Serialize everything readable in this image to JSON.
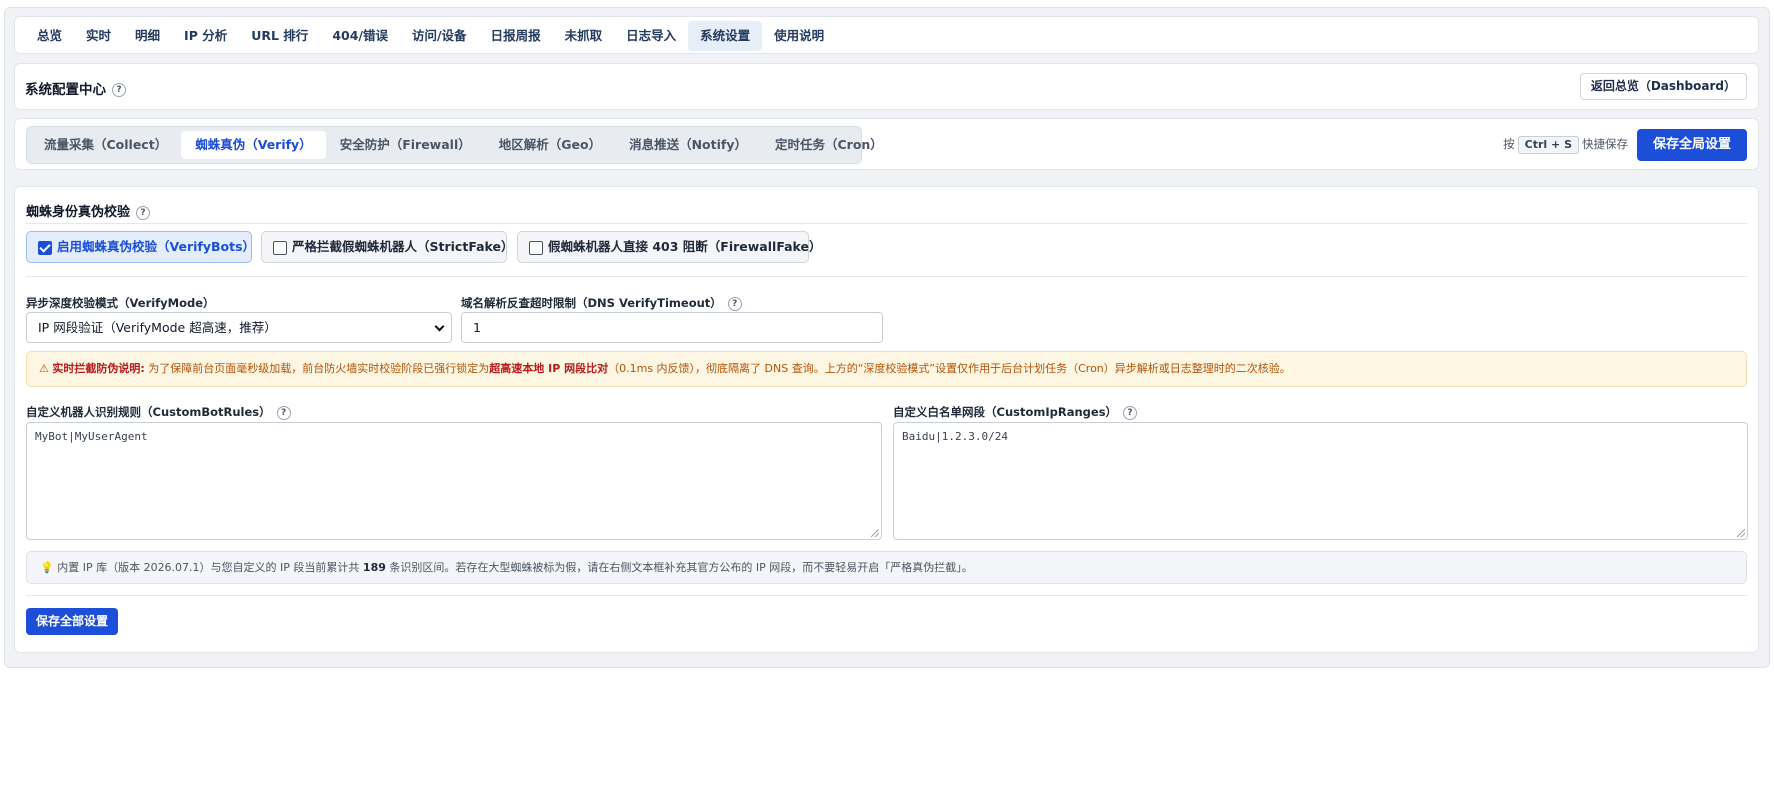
{
  "nav": {
    "items": [
      {
        "label": "总览"
      },
      {
        "label": "实时"
      },
      {
        "label": "明细"
      },
      {
        "label": "IP 分析"
      },
      {
        "label": "URL 排行"
      },
      {
        "label": "404/错误"
      },
      {
        "label": "访问/设备"
      },
      {
        "label": "日报周报"
      },
      {
        "label": "未抓取"
      },
      {
        "label": "日志导入"
      },
      {
        "label": "系统设置",
        "active": true
      },
      {
        "label": "使用说明"
      }
    ]
  },
  "header": {
    "title": "系统配置中心",
    "help": "?",
    "back_label": "返回总览（Dashboard）"
  },
  "subtabs": {
    "items": [
      {
        "label": "流量采集（Collect）"
      },
      {
        "label": "蜘蛛真伪（Verify）",
        "active": true
      },
      {
        "label": "安全防护（Firewall）"
      },
      {
        "label": "地区解析（Geo）"
      },
      {
        "label": "消息推送（Notify）"
      },
      {
        "label": "定时任务（Cron）"
      }
    ],
    "shortcut_prefix": "按",
    "shortcut_key": "Ctrl + S",
    "shortcut_suffix": "快捷保存",
    "save_label": "保存全局设置"
  },
  "verify": {
    "section_title": "蜘蛛身份真伪校验",
    "checks": {
      "verify_bots": {
        "label": "启用蜘蛛真伪校验（VerifyBots）",
        "checked": true
      },
      "strict_fake": {
        "label": "严格拦截假蜘蛛机器人（StrictFake）",
        "checked": false
      },
      "firewall_fake": {
        "label": "假蜘蛛机器人直接 403 阻断（FirewallFake）",
        "checked": false
      }
    },
    "mode_label": "异步深度校验模式（VerifyMode）",
    "mode_value": "IP 网段验证（VerifyMode 超高速，推荐）",
    "timeout_label": "域名解析反查超时限制（DNS VerifyTimeout）",
    "timeout_value": "1",
    "warning": {
      "icon": "⚠",
      "title": "实时拦截防伪说明:",
      "text1": " 为了保障前台页面毫秒级加载，前台防火墙实时校验阶段已强行锁定为",
      "highlight": "超高速本地 IP 网段比对",
      "text2": "（0.1ms 内反馈），彻底隔离了 DNS 查询。上方的“深度校验模式”设置仅作用于后台计划任务（Cron）异步解析或日志整理时的二次核验。"
    },
    "rules_label": "自定义机器人识别规则（CustomBotRules）",
    "rules_placeholder": "MyBot|MyUserAgent",
    "ranges_label": "自定义白名单网段（CustomIpRanges）",
    "ranges_placeholder": "Baidu|1.2.3.0/24",
    "tip": {
      "icon": "💡",
      "text1": " 内置 IP 库（版本 2026.07.1）与您自定义的 IP 段当前累计共 ",
      "count": "189",
      "text2": " 条识别区间。若存在大型蜘蛛被标为假，请在右侧文本框补充其官方公布的 IP 网段，而不要轻易开启「严格真伪拦截」。"
    },
    "save_all_label": "保存全部设置"
  }
}
